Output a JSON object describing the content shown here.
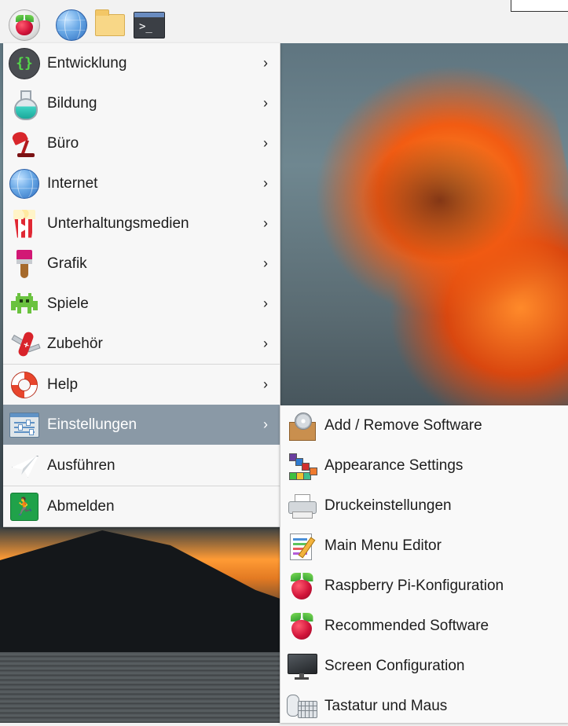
{
  "taskbar": {
    "buttons": [
      {
        "icon": "raspberry-pi-menu-icon"
      },
      {
        "icon": "web-browser-globe-icon"
      },
      {
        "icon": "file-manager-folder-icon"
      },
      {
        "icon": "terminal-icon",
        "glyph": ">_"
      }
    ]
  },
  "menu": {
    "items": [
      {
        "label": "Entwicklung",
        "icon": "programming-braces-icon",
        "has_submenu": true
      },
      {
        "label": "Bildung",
        "icon": "education-flask-icon",
        "has_submenu": true
      },
      {
        "label": "Büro",
        "icon": "office-desk-lamp-icon",
        "has_submenu": true
      },
      {
        "label": "Internet",
        "icon": "internet-globe-icon",
        "has_submenu": true
      },
      {
        "label": "Unterhaltungsmedien",
        "icon": "multimedia-popcorn-icon",
        "has_submenu": true
      },
      {
        "label": "Grafik",
        "icon": "graphics-paintbrush-icon",
        "has_submenu": true
      },
      {
        "label": "Spiele",
        "icon": "games-invader-icon",
        "has_submenu": true
      },
      {
        "label": "Zubehör",
        "icon": "accessories-pocketknife-icon",
        "has_submenu": true
      },
      {
        "label": "Help",
        "icon": "help-lifebuoy-icon",
        "has_submenu": true
      },
      {
        "label": "Einstellungen",
        "icon": "preferences-sliders-icon",
        "has_submenu": true,
        "active": true
      },
      {
        "label": "Ausführen",
        "icon": "run-paper-plane-icon",
        "has_submenu": false
      },
      {
        "label": "Abmelden",
        "icon": "logout-exit-icon",
        "has_submenu": false
      }
    ],
    "chevron": "›",
    "active_bg": "#8a99a6"
  },
  "submenu": {
    "items": [
      {
        "label": "Add / Remove Software",
        "icon": "package-install-icon"
      },
      {
        "label": "Appearance Settings",
        "icon": "appearance-palette-icon"
      },
      {
        "label": "Druckeinstellungen",
        "icon": "printer-icon"
      },
      {
        "label": "Main Menu Editor",
        "icon": "menu-editor-icon"
      },
      {
        "label": "Raspberry Pi-Konfiguration",
        "icon": "raspberry-pi-config-icon"
      },
      {
        "label": "Recommended Software",
        "icon": "raspberry-pi-recommended-icon"
      },
      {
        "label": "Screen Configuration",
        "icon": "monitor-icon"
      },
      {
        "label": "Tastatur und Maus",
        "icon": "keyboard-mouse-icon"
      }
    ]
  },
  "colors": {
    "panel_bg": "#f2f2f2",
    "menu_bg": "#f7f7f7",
    "active_item": "#8a99a6",
    "text": "#1d1d1d"
  }
}
